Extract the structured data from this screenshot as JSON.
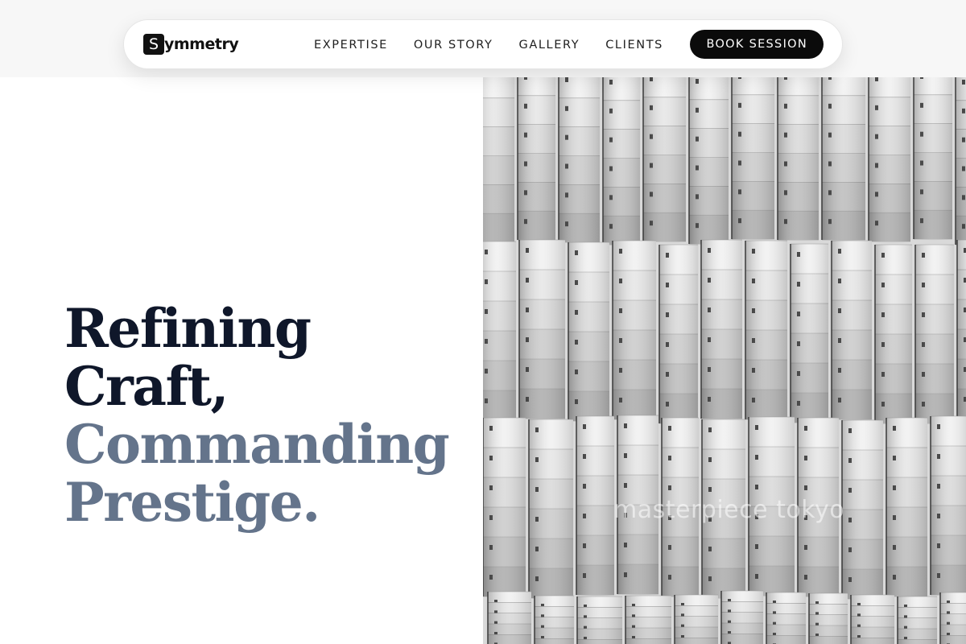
{
  "brand": {
    "mark": "S",
    "name": "ymmetry"
  },
  "nav": {
    "links": [
      "EXPERTISE",
      "OUR STORY",
      "GALLERY",
      "CLIENTS"
    ],
    "cta": "BOOK SESSION"
  },
  "hero": {
    "lines": [
      "Refining",
      "Craft,",
      "Commanding",
      "Prestige."
    ],
    "image_watermark": "masterpiece tokyo"
  },
  "colors": {
    "heading_dark": "#0f172a",
    "heading_accent": "#64748b",
    "cta_bg": "#0b0b0b"
  }
}
